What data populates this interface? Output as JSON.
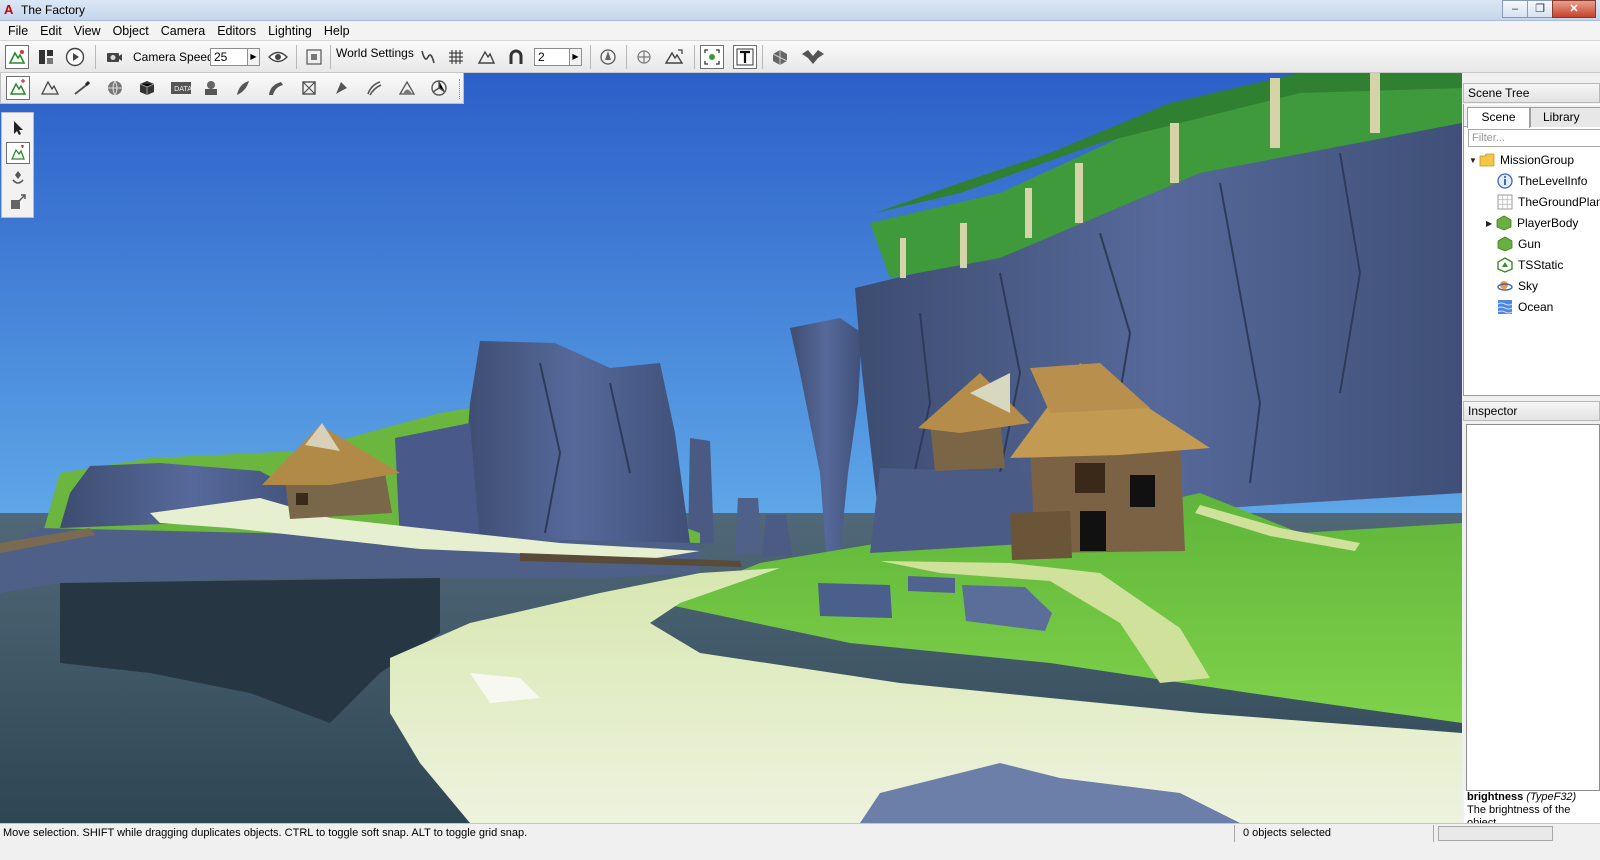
{
  "window": {
    "title": "The Factory",
    "logo_glyph": "A",
    "minimize_glyph": "–",
    "restore_glyph": "❐",
    "close_glyph": "✕"
  },
  "menu": [
    "File",
    "Edit",
    "View",
    "Object",
    "Camera",
    "Editors",
    "Lighting",
    "Help"
  ],
  "toolbar": {
    "camera_speed_label": "Camera Speed",
    "camera_speed_value": "25",
    "world_settings_label": "World Settings",
    "snap_value": "2",
    "spin_glyph": "▶"
  },
  "scene_tree": {
    "header": "Scene Tree",
    "tabs": [
      "Scene",
      "Library"
    ],
    "filter_placeholder": "Filter...",
    "items": [
      {
        "label": "MissionGroup",
        "icon": "folder-icon",
        "expander": "▼",
        "level": 0
      },
      {
        "label": "TheLevelInfo",
        "icon": "info-icon",
        "expander": "",
        "level": 1
      },
      {
        "label": "TheGroundPlane",
        "icon": "grid-icon",
        "expander": "",
        "level": 1
      },
      {
        "label": "PlayerBody",
        "icon": "shape-icon",
        "expander": "▶",
        "level": 1
      },
      {
        "label": "Gun",
        "icon": "shape-icon",
        "expander": "",
        "level": 1
      },
      {
        "label": "TSStatic",
        "icon": "static-shape-icon",
        "expander": "",
        "level": 1
      },
      {
        "label": "Sky",
        "icon": "sky-icon",
        "expander": "",
        "level": 1
      },
      {
        "label": "Ocean",
        "icon": "water-icon",
        "expander": "",
        "level": 1
      }
    ]
  },
  "inspector": {
    "header": "Inspector",
    "field_name": "brightness",
    "field_type": "(TypeF32)",
    "description": "The brightness of the object."
  },
  "status": {
    "hint": "Move selection.  SHIFT while dragging duplicates objects.  CTRL to toggle soft snap.  ALT to toggle grid snap.",
    "selection": "0 objects selected"
  },
  "colors": {
    "sky_top": "#3a6fd0",
    "sky_bottom": "#8fd0f0",
    "grass": "#6cc23a",
    "sand": "#e4edcc",
    "cliff": "#4d5f86",
    "water": "#3f5566"
  }
}
